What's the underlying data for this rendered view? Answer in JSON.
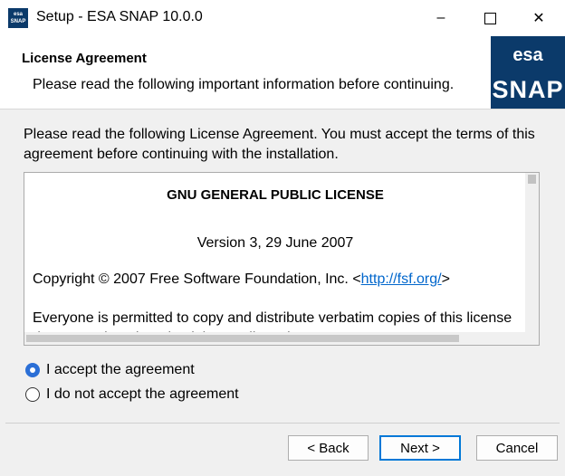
{
  "window": {
    "app_icon_label": "esa SNAP",
    "title": "Setup - ESA SNAP 10.0.0",
    "minimize_glyph": "–",
    "close_glyph": "✕"
  },
  "header": {
    "title": "License Agreement",
    "subtitle": "Please read the following important information before continuing.",
    "logo_esa": "esa",
    "logo_snap": "SNAP"
  },
  "main": {
    "intro": "Please read the following License Agreement. You must accept the terms of this agreement before continuing with the installation.",
    "license": {
      "title": "GNU GENERAL PUBLIC LICENSE",
      "version": "Version 3, 29 June 2007",
      "copyright_prefix": "Copyright © 2007 Free Software Foundation, Inc. <",
      "copyright_link": "http://fsf.org/",
      "copyright_suffix": ">",
      "permission": "Everyone is permitted to copy and distribute verbatim copies of this license document, but changing it is not allowed."
    },
    "options": {
      "accept_label": "I accept the agreement",
      "decline_label": "I do not accept the agreement",
      "selected": "accept"
    }
  },
  "buttons": {
    "back": "< Back",
    "next": "Next >",
    "cancel": "Cancel"
  },
  "colors": {
    "accent": "#0078d7",
    "logo_bg": "#0b3a6a",
    "link": "#0066cc"
  }
}
